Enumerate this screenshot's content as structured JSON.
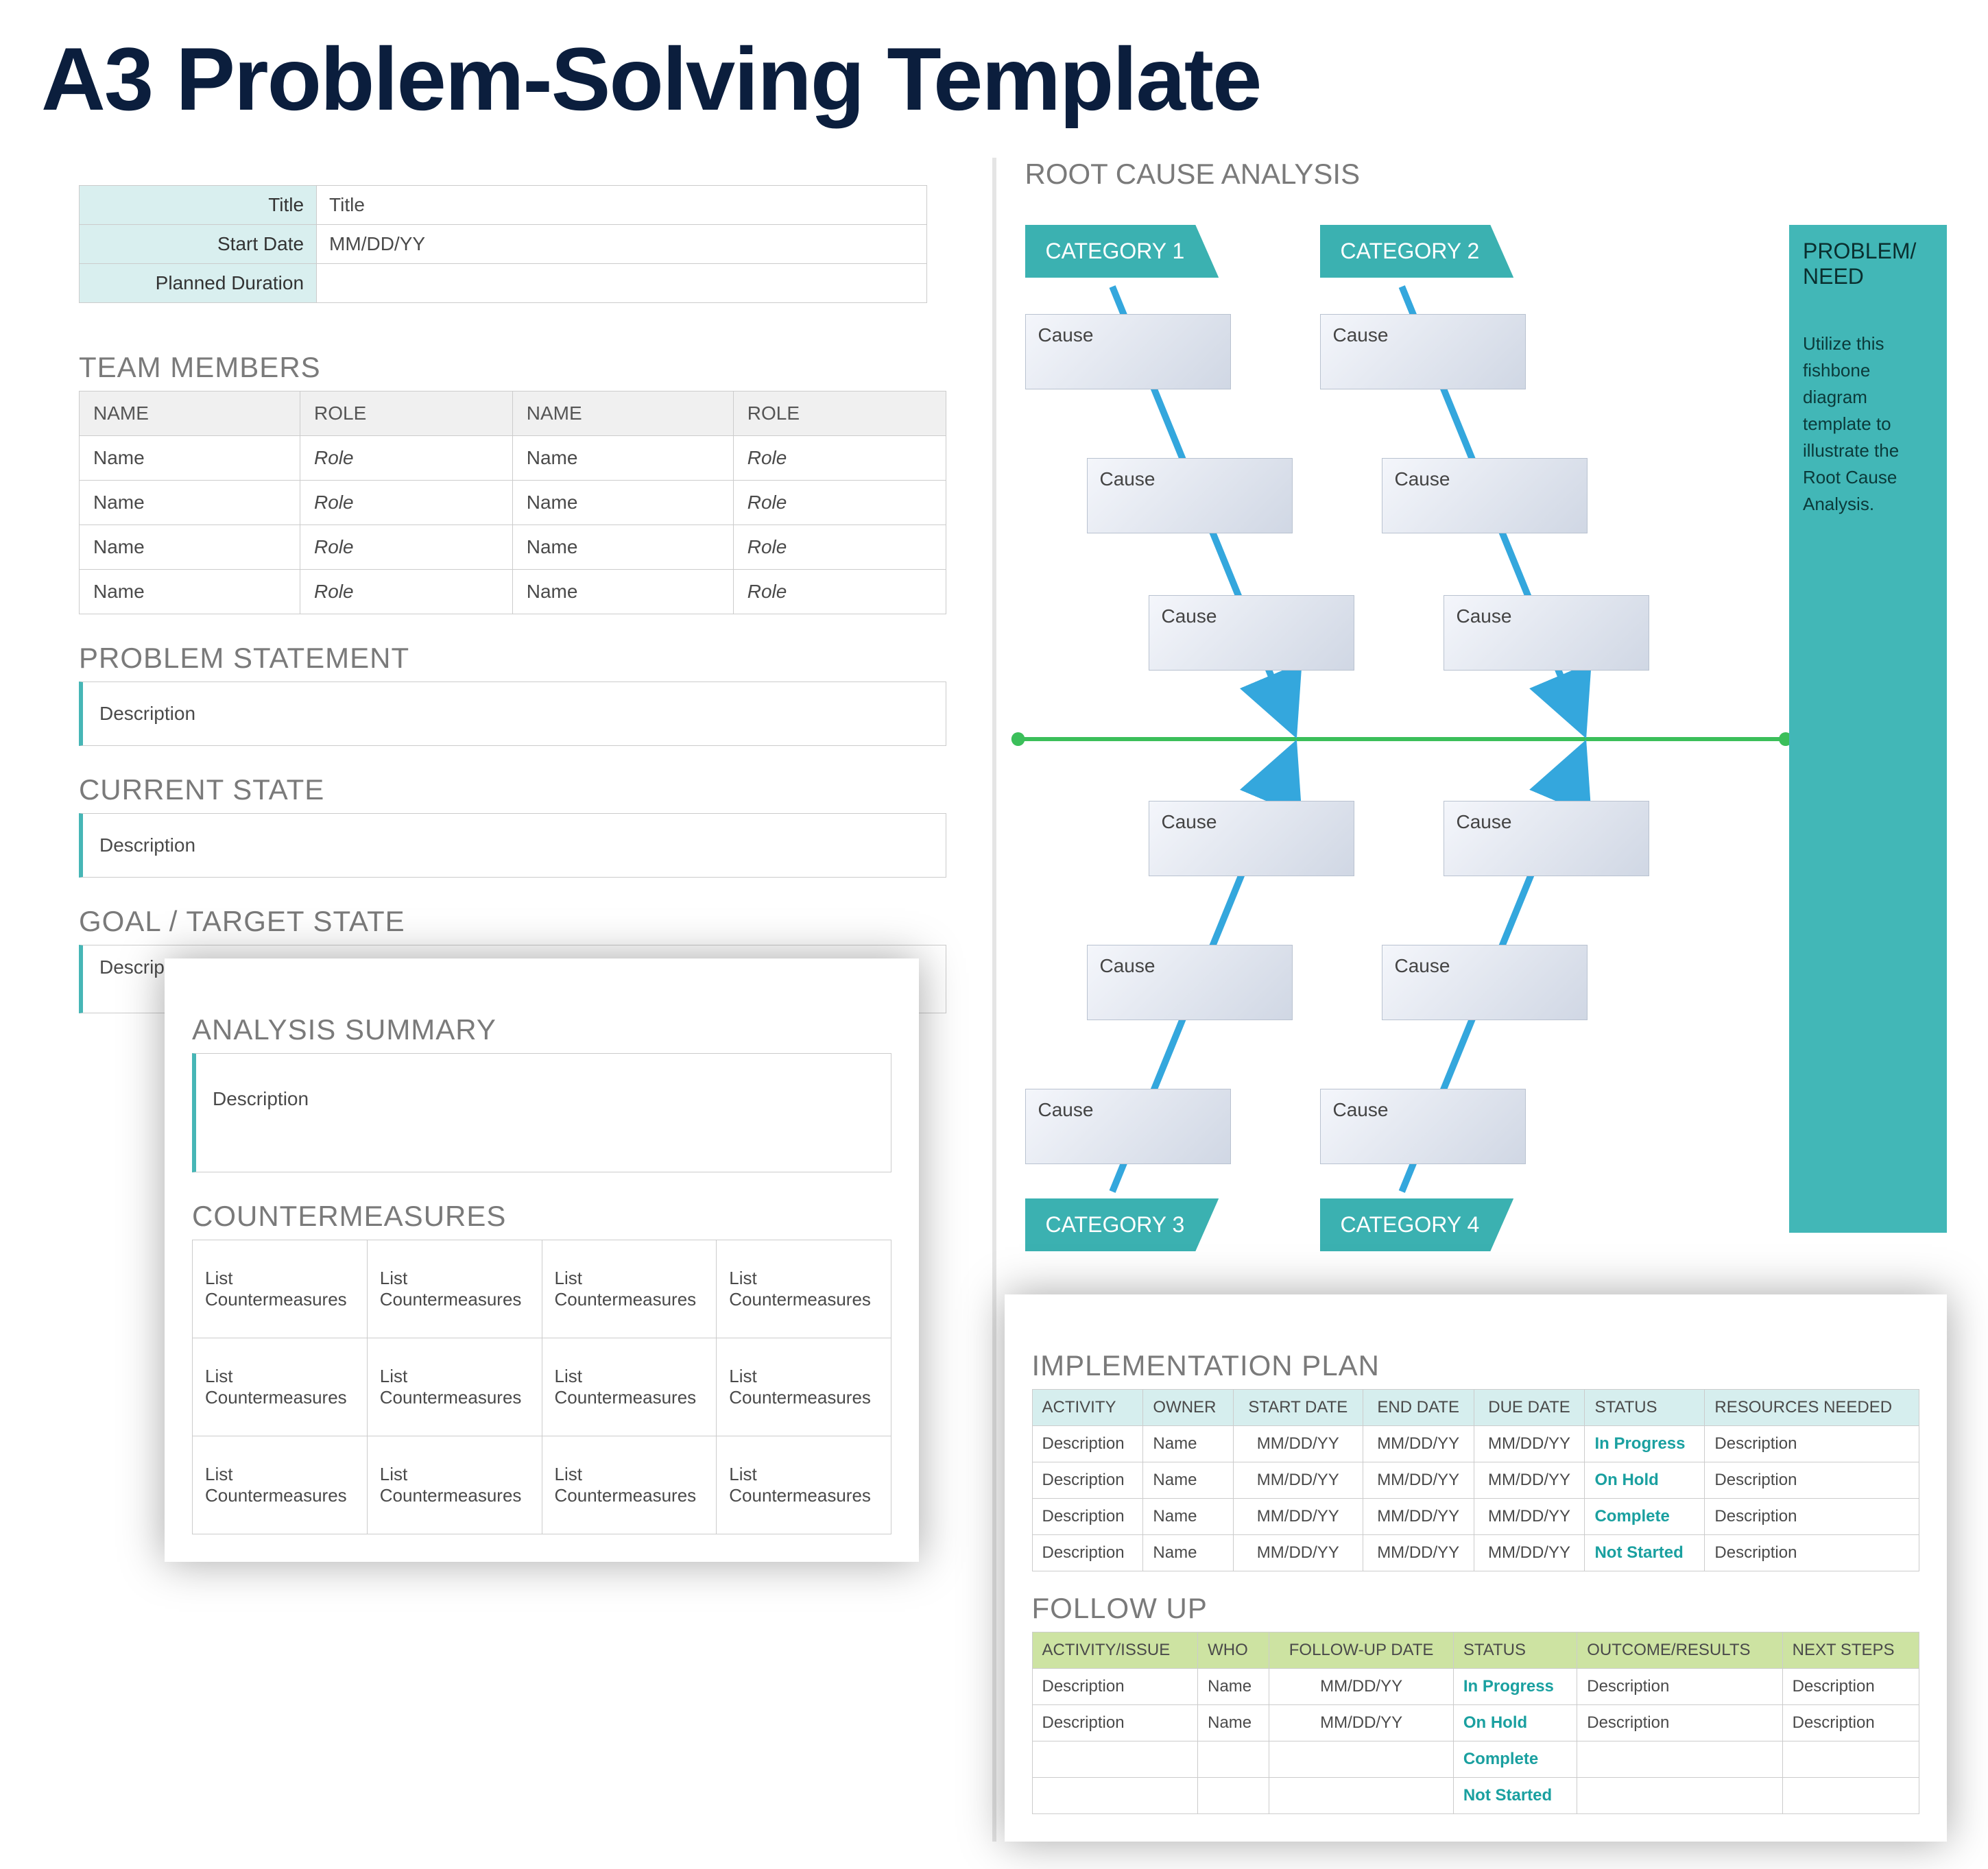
{
  "title": "A3 Problem-Solving Template",
  "meta": {
    "title_label": "Title",
    "title_value": "Title",
    "start_label": "Start Date",
    "start_value": "MM/DD/YY",
    "dur_label": "Planned Duration",
    "dur_value": ""
  },
  "team": {
    "heading": "TEAM MEMBERS",
    "headers": [
      "NAME",
      "ROLE",
      "NAME",
      "ROLE"
    ],
    "rows": [
      [
        "Name",
        "Role",
        "Name",
        "Role"
      ],
      [
        "Name",
        "Role",
        "Name",
        "Role"
      ],
      [
        "Name",
        "Role",
        "Name",
        "Role"
      ],
      [
        "Name",
        "Role",
        "Name",
        "Role"
      ]
    ]
  },
  "problem": {
    "heading": "PROBLEM STATEMENT",
    "text": "Description"
  },
  "current": {
    "heading": "CURRENT STATE",
    "text": "Description"
  },
  "goal": {
    "heading": "GOAL / TARGET STATE",
    "text": "Description"
  },
  "analysis": {
    "heading": "ANALYSIS SUMMARY",
    "text": "Description"
  },
  "counter": {
    "heading": "COUNTERMEASURES",
    "cell": "List Countermeasures",
    "rows": 3,
    "cols": 4
  },
  "rca": {
    "heading": "ROOT CAUSE ANALYSIS",
    "categories": [
      "CATEGORY 1",
      "CATEGORY 2",
      "CATEGORY 3",
      "CATEGORY 4"
    ],
    "cause": "Cause",
    "problem_title": "PROBLEM/ NEED",
    "problem_desc": "Utilize this fishbone diagram template to illustrate the Root Cause Analysis."
  },
  "impl": {
    "heading": "IMPLEMENTATION PLAN",
    "headers": [
      "ACTIVITY",
      "OWNER",
      "START DATE",
      "END DATE",
      "DUE DATE",
      "STATUS",
      "RESOURCES NEEDED"
    ],
    "rows": [
      [
        "Description",
        "Name",
        "MM/DD/YY",
        "MM/DD/YY",
        "MM/DD/YY",
        "In Progress",
        "Description"
      ],
      [
        "Description",
        "Name",
        "MM/DD/YY",
        "MM/DD/YY",
        "MM/DD/YY",
        "On Hold",
        "Description"
      ],
      [
        "Description",
        "Name",
        "MM/DD/YY",
        "MM/DD/YY",
        "MM/DD/YY",
        "Complete",
        "Description"
      ],
      [
        "Description",
        "Name",
        "MM/DD/YY",
        "MM/DD/YY",
        "MM/DD/YY",
        "Not Started",
        "Description"
      ]
    ]
  },
  "followup": {
    "heading": "FOLLOW UP",
    "headers": [
      "ACTIVITY/ISSUE",
      "WHO",
      "FOLLOW-UP DATE",
      "STATUS",
      "OUTCOME/RESULTS",
      "NEXT STEPS"
    ],
    "rows": [
      [
        "Description",
        "Name",
        "MM/DD/YY",
        "In Progress",
        "Description",
        "Description"
      ],
      [
        "Description",
        "Name",
        "MM/DD/YY",
        "On Hold",
        "Description",
        "Description"
      ],
      [
        "",
        "",
        "",
        "Complete",
        "",
        ""
      ],
      [
        "",
        "",
        "",
        "Not Started",
        "",
        ""
      ]
    ]
  }
}
